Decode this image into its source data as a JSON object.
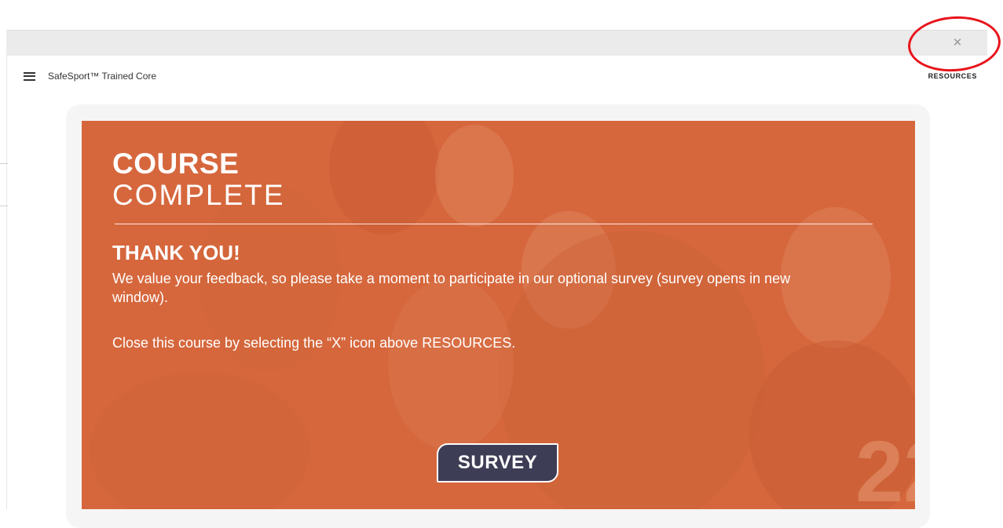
{
  "window": {
    "close_glyph": "✕"
  },
  "header": {
    "course_title": "SafeSport™ Trained Core",
    "resources_label": "RESOURCES"
  },
  "slide": {
    "heading_strong": "COURSE",
    "heading_light": "COMPLETE",
    "thank_you": "THANK YOU!",
    "message": "We value your feedback, so please take a moment to participate in our optional survey (survey opens in new window).",
    "close_instruction": "Close this course by selecting the “X” icon above RESOURCES.",
    "survey_label": "SURVEY",
    "background_color": "#d6673d"
  },
  "icons": {
    "menu": "menu-icon",
    "close": "close-icon"
  },
  "colors": {
    "slide_orange": "#d6673d",
    "button_navy": "#3d3d55",
    "annotation_red": "#e8141b"
  }
}
